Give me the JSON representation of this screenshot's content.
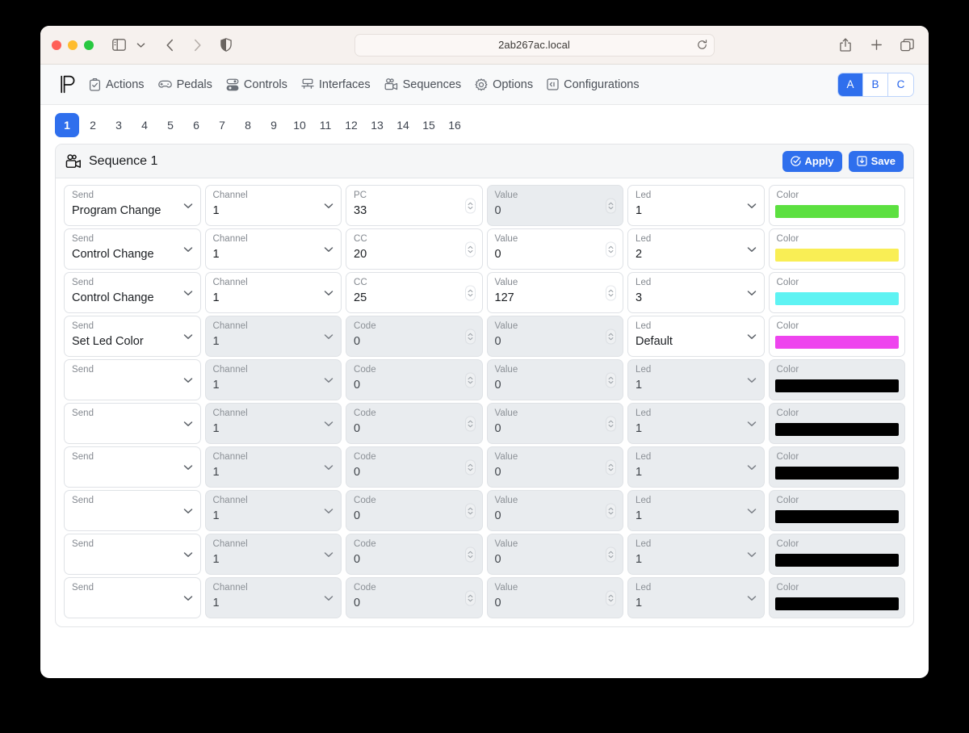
{
  "browser": {
    "url": "2ab267ac.local",
    "icons": {
      "sidebar": "sidebar-icon",
      "chevron_down": "chevron-down-icon",
      "back": "back-arrow-icon",
      "forward": "forward-arrow-icon",
      "shield": "shield-icon",
      "reload": "reload-icon",
      "share": "share-icon",
      "new_tab": "plus-icon",
      "tabs": "tab-overview-icon"
    }
  },
  "app": {
    "brand": "PedalinoMini logo",
    "nav": [
      {
        "label": "Actions",
        "icon": "clipboard-check-icon"
      },
      {
        "label": "Pedals",
        "icon": "gamepad-icon"
      },
      {
        "label": "Controls",
        "icon": "toggles-icon"
      },
      {
        "label": "Interfaces",
        "icon": "network-icon"
      },
      {
        "label": "Sequences",
        "icon": "video-camera-icon"
      },
      {
        "label": "Options",
        "icon": "gear-icon"
      },
      {
        "label": "Configurations",
        "icon": "code-box-icon"
      }
    ],
    "banks": {
      "items": [
        "A",
        "B",
        "C"
      ],
      "selected": "A"
    },
    "page_tabs": {
      "items": [
        "1",
        "2",
        "3",
        "4",
        "5",
        "6",
        "7",
        "8",
        "9",
        "10",
        "11",
        "12",
        "13",
        "14",
        "15",
        "16"
      ],
      "selected": "1"
    }
  },
  "sequence_card": {
    "icon": "video-camera-icon",
    "title": "Sequence 1",
    "apply_label": "Apply",
    "save_label": "Save",
    "apply_icon": "check-circle-icon",
    "save_icon": "save-download-icon",
    "columns": [
      "Send",
      "Channel",
      "Code",
      "Value",
      "Led",
      "Color"
    ],
    "rows": [
      {
        "send": {
          "label": "Send",
          "value": "Program Change",
          "disabled": false
        },
        "channel": {
          "label": "Channel",
          "value": "1",
          "disabled": false
        },
        "code": {
          "label": "PC",
          "value": "33",
          "disabled": false
        },
        "value": {
          "label": "Value",
          "value": "0",
          "disabled": true
        },
        "led": {
          "label": "Led",
          "value": "1",
          "disabled": false
        },
        "color": {
          "label": "Color",
          "value": "#5ce040",
          "disabled": false
        }
      },
      {
        "send": {
          "label": "Send",
          "value": "Control Change",
          "disabled": false
        },
        "channel": {
          "label": "Channel",
          "value": "1",
          "disabled": false
        },
        "code": {
          "label": "CC",
          "value": "20",
          "disabled": false
        },
        "value": {
          "label": "Value",
          "value": "0",
          "disabled": false
        },
        "led": {
          "label": "Led",
          "value": "2",
          "disabled": false
        },
        "color": {
          "label": "Color",
          "value": "#f9ee55",
          "disabled": false
        }
      },
      {
        "send": {
          "label": "Send",
          "value": "Control Change",
          "disabled": false
        },
        "channel": {
          "label": "Channel",
          "value": "1",
          "disabled": false
        },
        "code": {
          "label": "CC",
          "value": "25",
          "disabled": false
        },
        "value": {
          "label": "Value",
          "value": "127",
          "disabled": false
        },
        "led": {
          "label": "Led",
          "value": "3",
          "disabled": false
        },
        "color": {
          "label": "Color",
          "value": "#5ef3f3",
          "disabled": false
        }
      },
      {
        "send": {
          "label": "Send",
          "value": "Set Led Color",
          "disabled": false
        },
        "channel": {
          "label": "Channel",
          "value": "1",
          "disabled": true
        },
        "code": {
          "label": "Code",
          "value": "0",
          "disabled": true
        },
        "value": {
          "label": "Value",
          "value": "0",
          "disabled": true
        },
        "led": {
          "label": "Led",
          "value": "Default",
          "disabled": false
        },
        "color": {
          "label": "Color",
          "value": "#ee44ee",
          "disabled": false
        }
      },
      {
        "send": {
          "label": "Send",
          "value": "",
          "disabled": false
        },
        "channel": {
          "label": "Channel",
          "value": "1",
          "disabled": true
        },
        "code": {
          "label": "Code",
          "value": "0",
          "disabled": true
        },
        "value": {
          "label": "Value",
          "value": "0",
          "disabled": true
        },
        "led": {
          "label": "Led",
          "value": "1",
          "disabled": true
        },
        "color": {
          "label": "Color",
          "value": "#000000",
          "disabled": true
        }
      },
      {
        "send": {
          "label": "Send",
          "value": "",
          "disabled": false
        },
        "channel": {
          "label": "Channel",
          "value": "1",
          "disabled": true
        },
        "code": {
          "label": "Code",
          "value": "0",
          "disabled": true
        },
        "value": {
          "label": "Value",
          "value": "0",
          "disabled": true
        },
        "led": {
          "label": "Led",
          "value": "1",
          "disabled": true
        },
        "color": {
          "label": "Color",
          "value": "#000000",
          "disabled": true
        }
      },
      {
        "send": {
          "label": "Send",
          "value": "",
          "disabled": false
        },
        "channel": {
          "label": "Channel",
          "value": "1",
          "disabled": true
        },
        "code": {
          "label": "Code",
          "value": "0",
          "disabled": true
        },
        "value": {
          "label": "Value",
          "value": "0",
          "disabled": true
        },
        "led": {
          "label": "Led",
          "value": "1",
          "disabled": true
        },
        "color": {
          "label": "Color",
          "value": "#000000",
          "disabled": true
        }
      },
      {
        "send": {
          "label": "Send",
          "value": "",
          "disabled": false
        },
        "channel": {
          "label": "Channel",
          "value": "1",
          "disabled": true
        },
        "code": {
          "label": "Code",
          "value": "0",
          "disabled": true
        },
        "value": {
          "label": "Value",
          "value": "0",
          "disabled": true
        },
        "led": {
          "label": "Led",
          "value": "1",
          "disabled": true
        },
        "color": {
          "label": "Color",
          "value": "#000000",
          "disabled": true
        }
      },
      {
        "send": {
          "label": "Send",
          "value": "",
          "disabled": false
        },
        "channel": {
          "label": "Channel",
          "value": "1",
          "disabled": true
        },
        "code": {
          "label": "Code",
          "value": "0",
          "disabled": true
        },
        "value": {
          "label": "Value",
          "value": "0",
          "disabled": true
        },
        "led": {
          "label": "Led",
          "value": "1",
          "disabled": true
        },
        "color": {
          "label": "Color",
          "value": "#000000",
          "disabled": true
        }
      },
      {
        "send": {
          "label": "Send",
          "value": "",
          "disabled": false
        },
        "channel": {
          "label": "Channel",
          "value": "1",
          "disabled": true
        },
        "code": {
          "label": "Code",
          "value": "0",
          "disabled": true
        },
        "value": {
          "label": "Value",
          "value": "0",
          "disabled": true
        },
        "led": {
          "label": "Led",
          "value": "1",
          "disabled": true
        },
        "color": {
          "label": "Color",
          "value": "#000000",
          "disabled": true
        }
      }
    ]
  },
  "theme": {
    "accent": "#2f6fed",
    "accent_light": "#bcd3fb",
    "disabled_bg": "#e9ecef",
    "border": "#dfe2e6"
  }
}
